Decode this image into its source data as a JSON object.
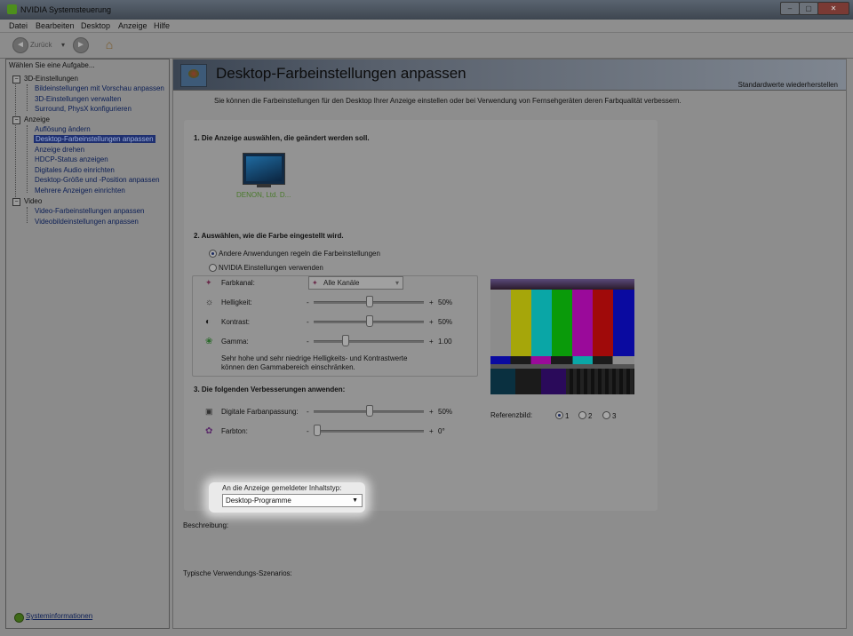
{
  "window": {
    "title": "NVIDIA Systemsteuerung",
    "min": "–",
    "max": "▢",
    "close": "✕"
  },
  "menu": [
    "Datei",
    "Bearbeiten",
    "Desktop",
    "Anzeige",
    "Hilfe"
  ],
  "toolbar": {
    "back_label": "Zurück",
    "back_arrow": "◄",
    "fwd_arrow": "►",
    "dropdown_arrow": "▾",
    "home": "⌂"
  },
  "sidebar": {
    "title": "Wählen Sie eine Aufgabe...",
    "categories": [
      {
        "label": "3D-Einstellungen",
        "items": [
          "Bildeinstellungen mit Vorschau anpassen",
          "3D-Einstellungen verwalten",
          "Surround, PhysX konfigurieren"
        ]
      },
      {
        "label": "Anzeige",
        "items": [
          "Auflösung ändern",
          "Desktop-Farbeinstellungen anpassen",
          "Anzeige drehen",
          "HDCP-Status anzeigen",
          "Digitales Audio einrichten",
          "Desktop-Größe und -Position anpassen",
          "Mehrere Anzeigen einrichten"
        ]
      },
      {
        "label": "Video",
        "items": [
          "Video-Farbeinstellungen anpassen",
          "Videobildeinstellungen anpassen"
        ]
      }
    ],
    "collapse_glyph": "−",
    "system_info": "Systeminformationen"
  },
  "page": {
    "title": "Desktop-Farbeinstellungen anpassen",
    "restore_defaults": "Standardwerte wiederherstellen",
    "description": "Sie können die Farbeinstellungen für den Desktop Ihrer Anzeige einstellen oder bei Verwendung von Fernsehgeräten deren Farbqualität verbessern.",
    "step1": "1. Die Anzeige auswählen, die geändert werden soll.",
    "monitor_label": "DENON, Ltd. D...",
    "step2": "2. Auswählen, wie die Farbe eingestellt wird.",
    "radio_other_apps": "Andere Anwendungen regeln die Farbeinstellungen",
    "radio_nvidia": "NVIDIA Einstellungen verwenden",
    "channel_label": "Farbkanal:",
    "channel_value": "Alle Kanäle",
    "channel_arrow": "▾",
    "minus": "-",
    "plus": "+",
    "sliders": [
      {
        "label": "Helligkeit:",
        "value": "50%",
        "fraction": 0.5
      },
      {
        "label": "Kontrast:",
        "value": "50%",
        "fraction": 0.5
      },
      {
        "label": "Gamma:",
        "value": "1.00",
        "fraction": 0.27
      }
    ],
    "note": "Sehr hohe und sehr niedrige Helligkeits- und Kontrastwerte können den Gammabereich einschränken.",
    "step3": "3. Die folgenden Verbesserungen anwenden:",
    "enhancements": [
      {
        "label": "Digitale Farbanpassung:",
        "value": "50%",
        "fraction": 0.5
      },
      {
        "label": "Farbton:",
        "value": "0°",
        "fraction": 0.0
      }
    ],
    "content_type_label": "An die Anzeige gemeldeter Inhaltstyp:",
    "content_type_value": "Desktop-Programme",
    "content_type_arrow": "▼",
    "reference_label": "Referenzbild:",
    "reference_options": [
      "1",
      "2",
      "3"
    ],
    "reference_selected": "1",
    "beschreibung": "Beschreibung:",
    "scenarios": "Typische Verwendungs-Szenarios:"
  },
  "colors": {
    "test_bars": [
      "#8c8c8c",
      "#a6a60a",
      "#0aa6a6",
      "#0a9a0a",
      "#9a0a9a",
      "#a00a0a",
      "#0a0aa0"
    ],
    "selected_bg": "#1f3070",
    "link": "#0b1e55",
    "nvidia_green": "#4d8f1c"
  }
}
